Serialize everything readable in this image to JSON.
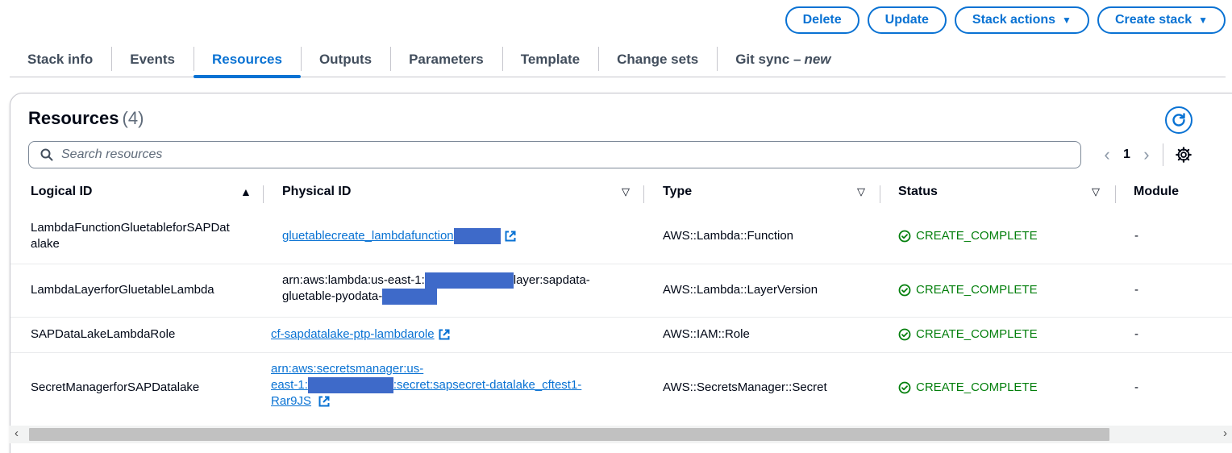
{
  "actions": {
    "delete": "Delete",
    "update": "Update",
    "stack_actions": "Stack actions",
    "create_stack": "Create stack"
  },
  "tabs": [
    {
      "label": "Stack info"
    },
    {
      "label": "Events"
    },
    {
      "label": "Resources",
      "active": true
    },
    {
      "label": "Outputs"
    },
    {
      "label": "Parameters"
    },
    {
      "label": "Template"
    },
    {
      "label": "Change sets"
    },
    {
      "label": "Git sync –",
      "badge": "new"
    }
  ],
  "resources": {
    "title": "Resources",
    "count": "(4)",
    "search_placeholder": "Search resources",
    "page": "1",
    "columns": {
      "logical_id": "Logical ID",
      "physical_id": "Physical ID",
      "type": "Type",
      "status": "Status",
      "module": "Module"
    },
    "rows": [
      {
        "logical_id_1": "LambdaFunctionGluetableforSAPDat",
        "logical_id_2": "alake",
        "physical_id": "gluetablecreate_lambdafunction",
        "type": "AWS::Lambda::Function",
        "status": "CREATE_COMPLETE",
        "module": "-"
      },
      {
        "logical_id": "LambdaLayerforGluetableLambda",
        "physical_id_1a": "arn:aws:lambda:us-east-1:",
        "physical_id_1b": "layer:sapdata-",
        "physical_id_2": "gluetable-pyodata-",
        "type": "AWS::Lambda::LayerVersion",
        "status": "CREATE_COMPLETE",
        "module": "-"
      },
      {
        "logical_id": "SAPDataLakeLambdaRole",
        "physical_id": "cf-sapdatalake-ptp-lambdarole",
        "type": "AWS::IAM::Role",
        "status": "CREATE_COMPLETE",
        "module": "-"
      },
      {
        "logical_id": "SecretManagerforSAPDatalake",
        "physical_id_1": "arn:aws:secretsmanager:us-",
        "physical_id_2a": "east-1:",
        "physical_id_2b": ":secret:sapsecret-datalake_cftest1-",
        "physical_id_3": "Rar9JS",
        "type": "AWS::SecretsManager::Secret",
        "status": "CREATE_COMPLETE",
        "module": "-"
      }
    ]
  },
  "colors": {
    "accent": "#0972d3",
    "success": "#037f0c",
    "redaction": "#3e6ac9"
  }
}
